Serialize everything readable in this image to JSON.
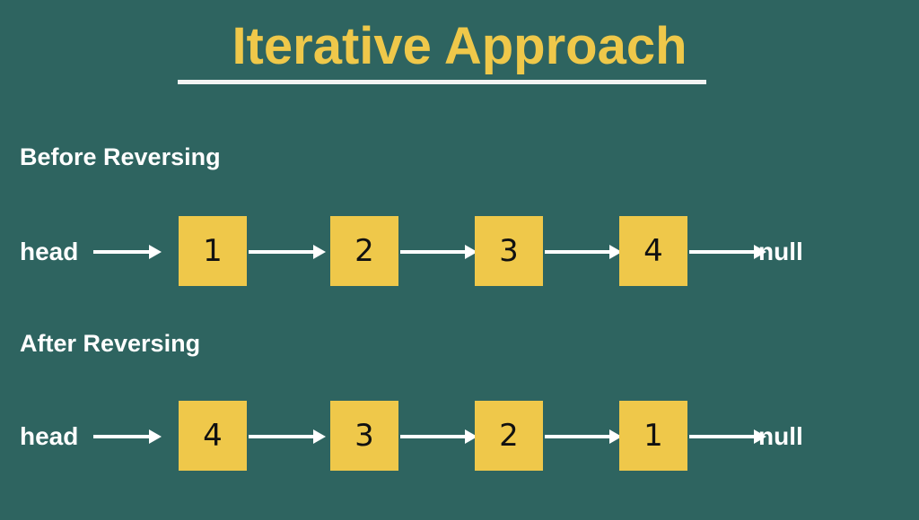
{
  "slide": {
    "background_color": "#2e6460",
    "accent_color": "#efc84a",
    "text_color": "#ffffff",
    "node_text_color": "#111111",
    "title": "Iterative Approach"
  },
  "sections": [
    {
      "heading": "Before Reversing",
      "head_label": "head",
      "nodes": [
        "1",
        "2",
        "3",
        "4"
      ],
      "terminator": "null"
    },
    {
      "heading": "After Reversing",
      "head_label": "head",
      "nodes": [
        "4",
        "3",
        "2",
        "1"
      ],
      "terminator": "null"
    }
  ]
}
